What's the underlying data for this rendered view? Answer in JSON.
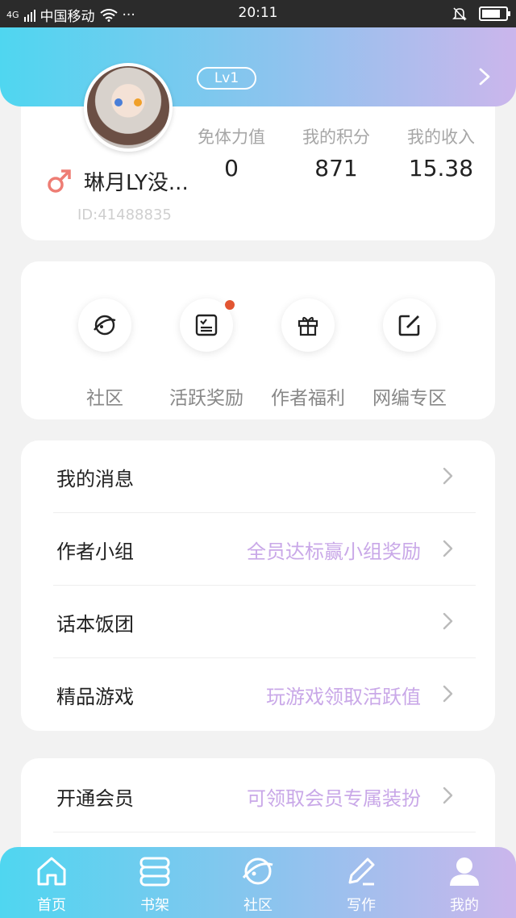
{
  "status_bar": {
    "network": "4G",
    "carrier": "中国移动",
    "time": "20:11",
    "battery_level": 0.8
  },
  "header": {
    "level": "Lv1",
    "arrow_icon": "chevron-right-icon"
  },
  "profile": {
    "username": "琳月LY没...",
    "user_id": "ID:41488835",
    "stats": [
      {
        "label": "免体力值",
        "value": "0"
      },
      {
        "label": "我的积分",
        "value": "871"
      },
      {
        "label": "我的收入",
        "value": "15.38"
      }
    ]
  },
  "quick_actions": [
    {
      "label": "社区",
      "icon": "planet-icon",
      "badge": false
    },
    {
      "label": "活跃奖励",
      "icon": "checklist-icon",
      "badge": true
    },
    {
      "label": "作者福利",
      "icon": "gift-icon",
      "badge": false
    },
    {
      "label": "网编专区",
      "icon": "edit-icon",
      "badge": false
    }
  ],
  "menu": {
    "group1": [
      {
        "label": "我的消息",
        "hint": ""
      },
      {
        "label": "作者小组",
        "hint": "全员达标赢小组奖励"
      },
      {
        "label": "话本饭团",
        "hint": ""
      },
      {
        "label": "精品游戏",
        "hint": "玩游戏领取活跃值"
      }
    ],
    "group2": [
      {
        "label": "开通会员",
        "hint": "可领取会员专属装扮"
      }
    ]
  },
  "bottom_nav": [
    {
      "label": "首页",
      "icon": "home-icon"
    },
    {
      "label": "书架",
      "icon": "bookshelf-icon"
    },
    {
      "label": "社区",
      "icon": "planet-icon"
    },
    {
      "label": "写作",
      "icon": "pen-icon"
    },
    {
      "label": "我的",
      "icon": "user-icon",
      "active": true
    }
  ],
  "colors": {
    "gradient_start": "#4fd6f0",
    "gradient_end": "#cbb6ec",
    "hint_purple": "#c9a8e8",
    "badge_red": "#e25532",
    "gender_icon": "#ee7d74"
  }
}
